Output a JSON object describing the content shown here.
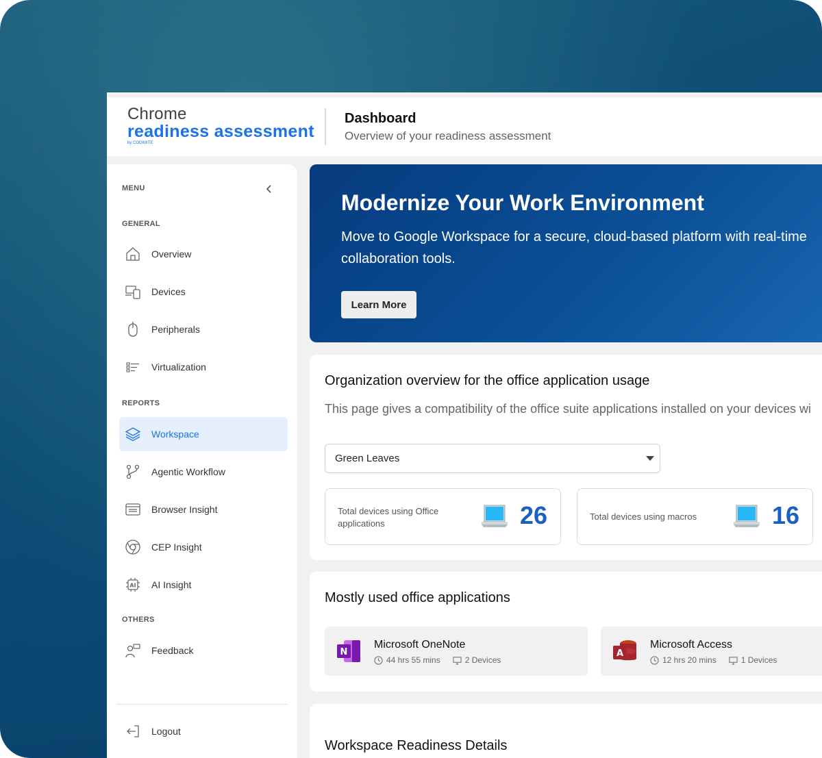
{
  "header": {
    "logo_line1": "Chrome",
    "logo_line2": "readiness assessment",
    "logo_line3": "by CODIMITE",
    "title": "Dashboard",
    "subtitle": "Overview of your readiness assessment"
  },
  "sidebar": {
    "menu_label": "MENU",
    "collapse_icon": "chevron-left-icon",
    "general_label": "GENERAL",
    "reports_label": "REPORTS",
    "others_label": "OTHERS",
    "items": [
      {
        "label": "Overview",
        "icon": "home-icon"
      },
      {
        "label": "Devices",
        "icon": "devices-icon"
      },
      {
        "label": "Peripherals",
        "icon": "mouse-icon"
      },
      {
        "label": "Virtualization",
        "icon": "list-icon"
      },
      {
        "label": "Workspace",
        "icon": "layers-icon",
        "active": true
      },
      {
        "label": "Agentic Workflow",
        "icon": "workflow-icon"
      },
      {
        "label": "Browser Insight",
        "icon": "browser-icon"
      },
      {
        "label": "CEP Insight",
        "icon": "chrome-icon"
      },
      {
        "label": "AI Insight",
        "icon": "ai-icon"
      },
      {
        "label": "Feedback",
        "icon": "feedback-icon"
      }
    ],
    "logout_label": "Logout"
  },
  "hero": {
    "title": "Modernize Your Work Environment",
    "text": "Move to Google Workspace for a secure, cloud-based platform with real-time collaboration tools.",
    "button_label": "Learn More"
  },
  "org_overview": {
    "title": "Organization overview for the office application usage",
    "description": "This page gives a compatibility of the office suite applications installed on your devices wi",
    "dropdown_value": "Green Leaves",
    "stats": [
      {
        "label": "Total devices using Office applications",
        "value": "26"
      },
      {
        "label": "Total devices using macros",
        "value": "16"
      }
    ]
  },
  "most_used": {
    "title": "Mostly used office applications",
    "apps": [
      {
        "name": "Microsoft OneNote",
        "time": "44 hrs 55 mins",
        "devices": "2 Devices",
        "icon": "onenote-icon",
        "color": "#7719aa"
      },
      {
        "name": "Microsoft Access",
        "time": "12 hrs 20 mins",
        "devices": "1 Devices",
        "icon": "access-icon",
        "color": "#a4262c"
      }
    ]
  },
  "details": {
    "title": "Workspace Readiness Details"
  },
  "colors": {
    "accent": "#1a73e8",
    "hero_bg": "#0a4f96",
    "stat_value": "#1a5fc4"
  }
}
